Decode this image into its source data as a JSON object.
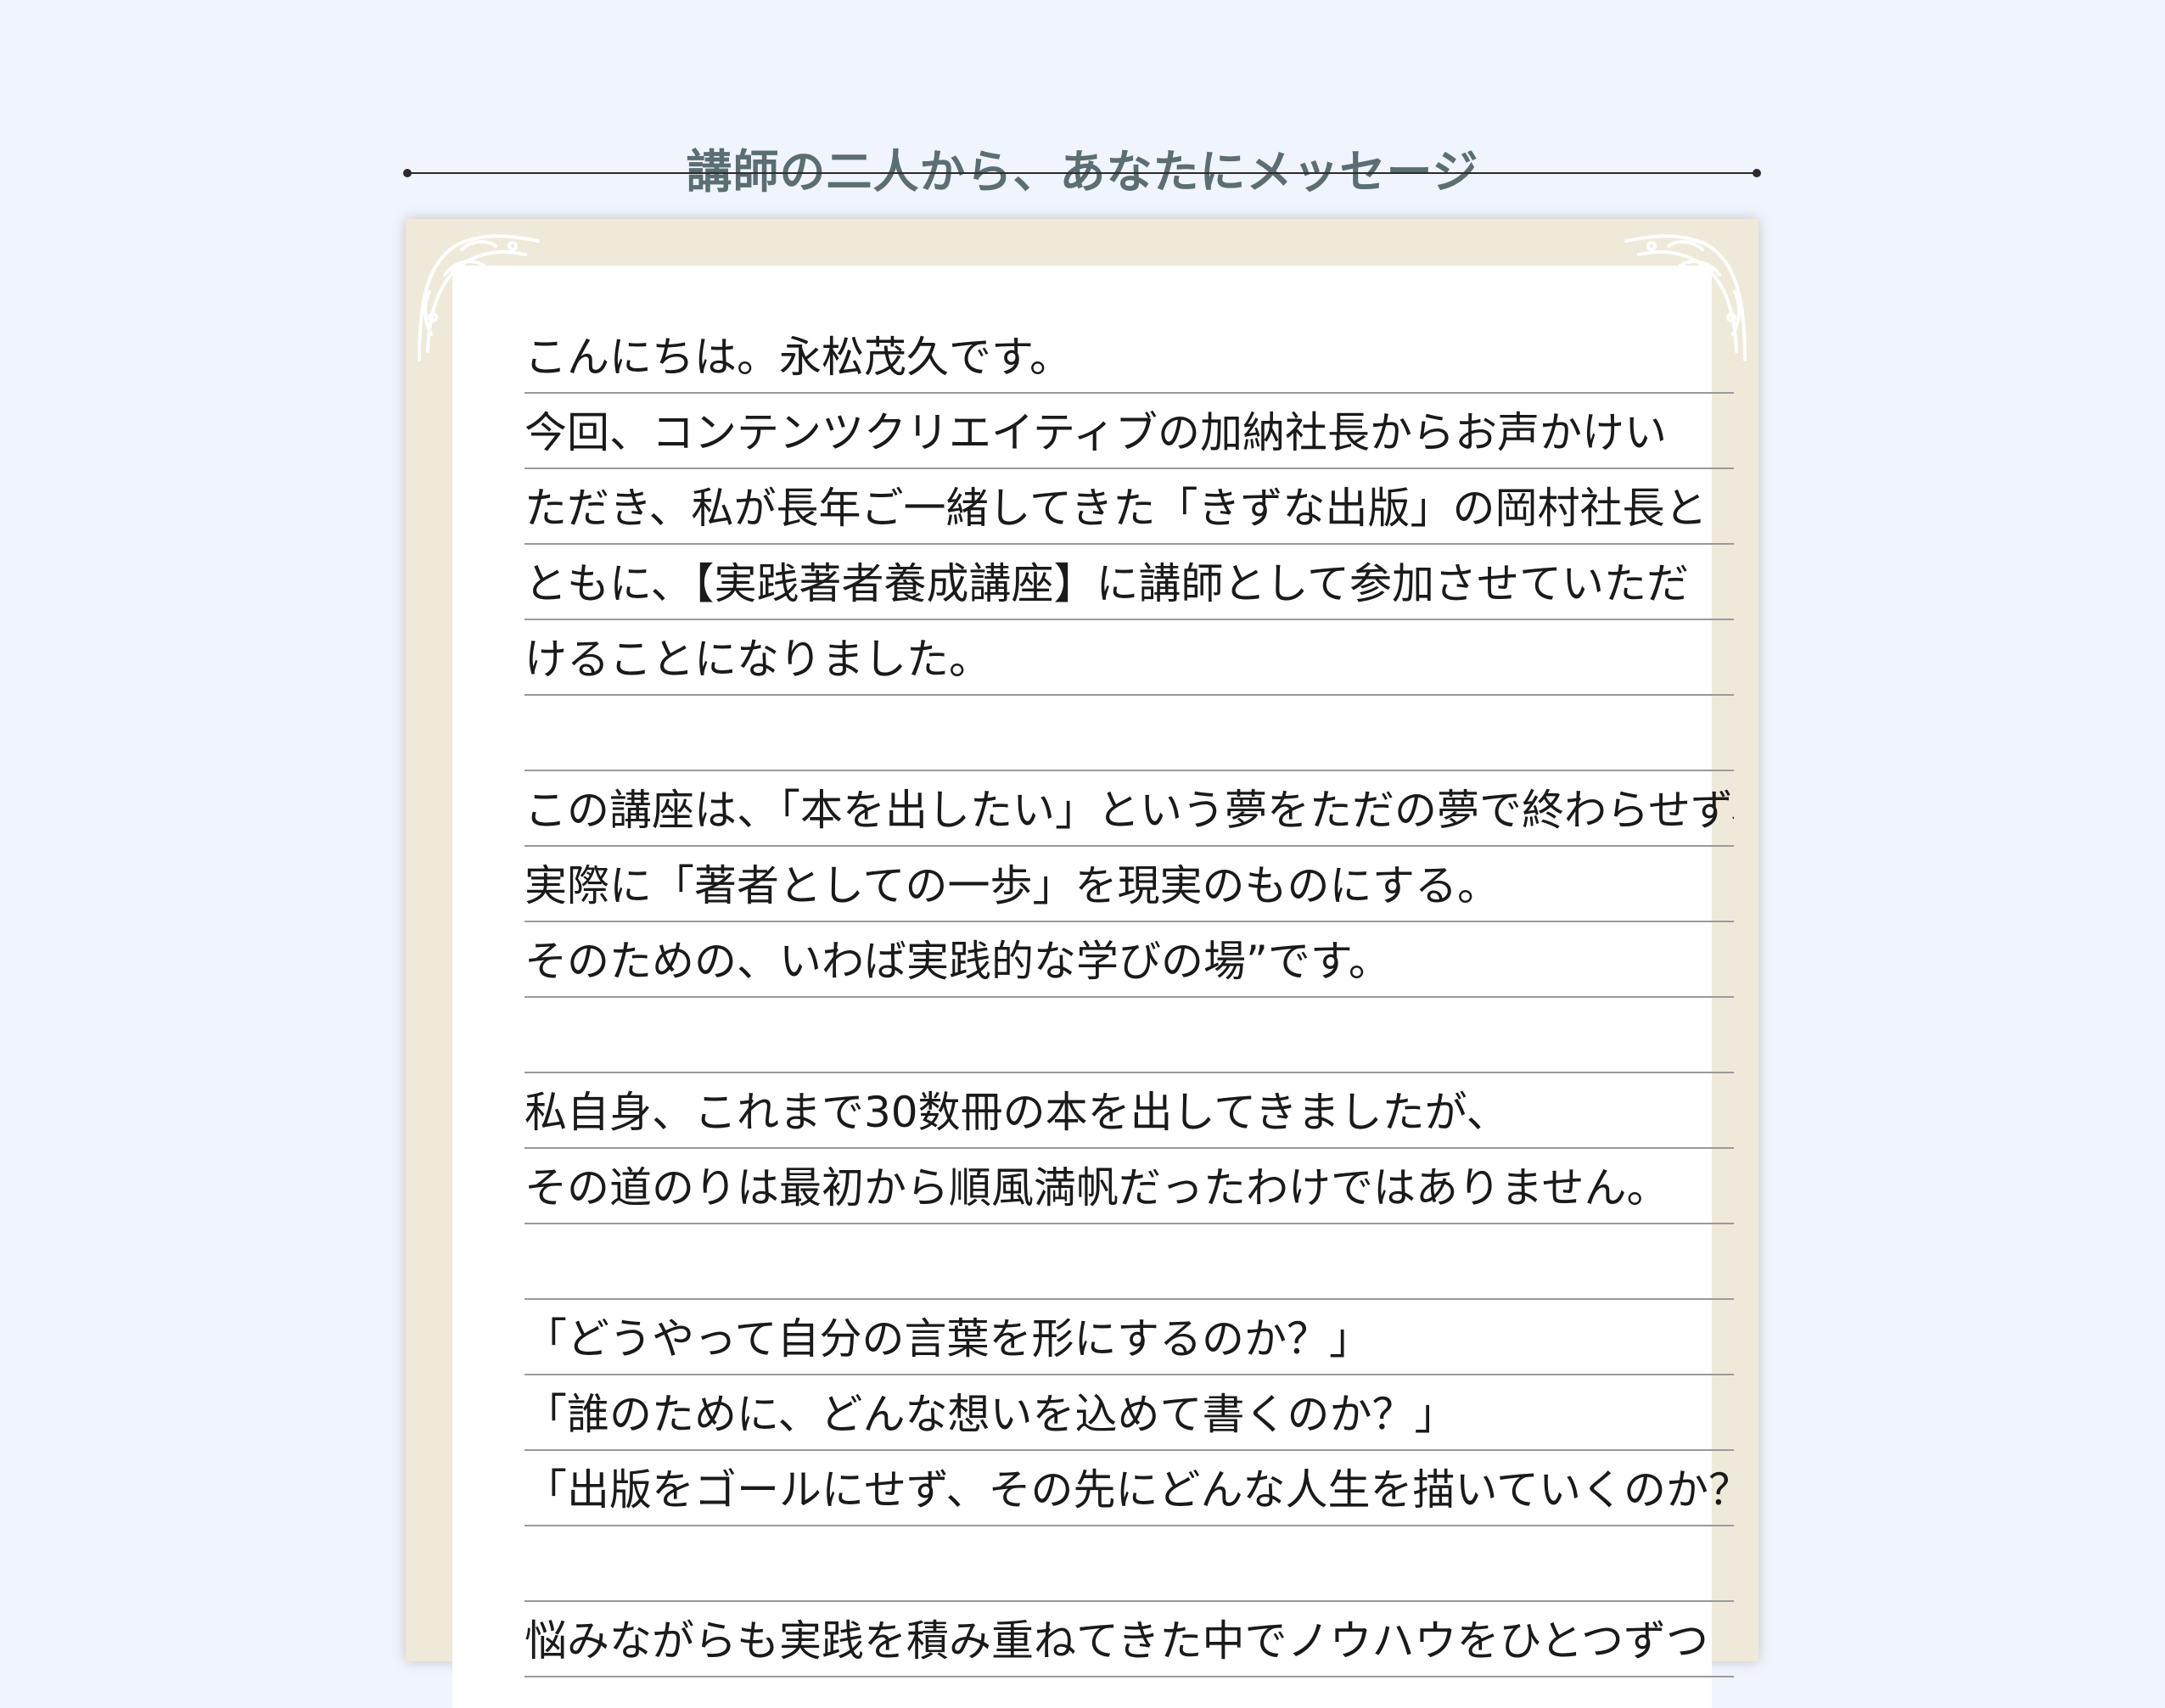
{
  "section": {
    "title": "講師の二人から、あなたにメッセージ"
  },
  "message": {
    "lines": [
      "こんにちは。永松茂久です。",
      "今回、コンテンツクリエイティブの加納社長からお声かけい",
      "ただき、私が長年ご一緒してきた「きずな出版」の岡村社長と",
      "ともに、【実践著者養成講座】に講師として参加させていただ",
      "けることになりました。",
      "",
      "この講座は、「本を出したい」という夢をただの夢で終わらせず、",
      "実際に「著者としての一歩」を現実のものにする。",
      "そのための、いわば実践的な学びの場”です。",
      "",
      "私自身、これまで30数冊の本を出してきましたが、",
      "その道のりは最初から順風満帆だったわけではありません。",
      "",
      "「どうやって自分の言葉を形にするのか？」",
      "「誰のために、どんな想いを込めて書くのか？」",
      "「出版をゴールにせず、その先にどんな人生を描いていくのか？」",
      "",
      "悩みながらも実践を積み重ねてきた中でノウハウをひとつずつ"
    ]
  },
  "colors": {
    "background": "#f0f4fd",
    "heading": "#5b6e72",
    "card_frame": "#efe9d9",
    "rule": "#9a9a9a",
    "text": "#1a1a1a"
  },
  "icons": {
    "corner_top_left": "flourish-ornament",
    "corner_top_right": "flourish-ornament"
  }
}
